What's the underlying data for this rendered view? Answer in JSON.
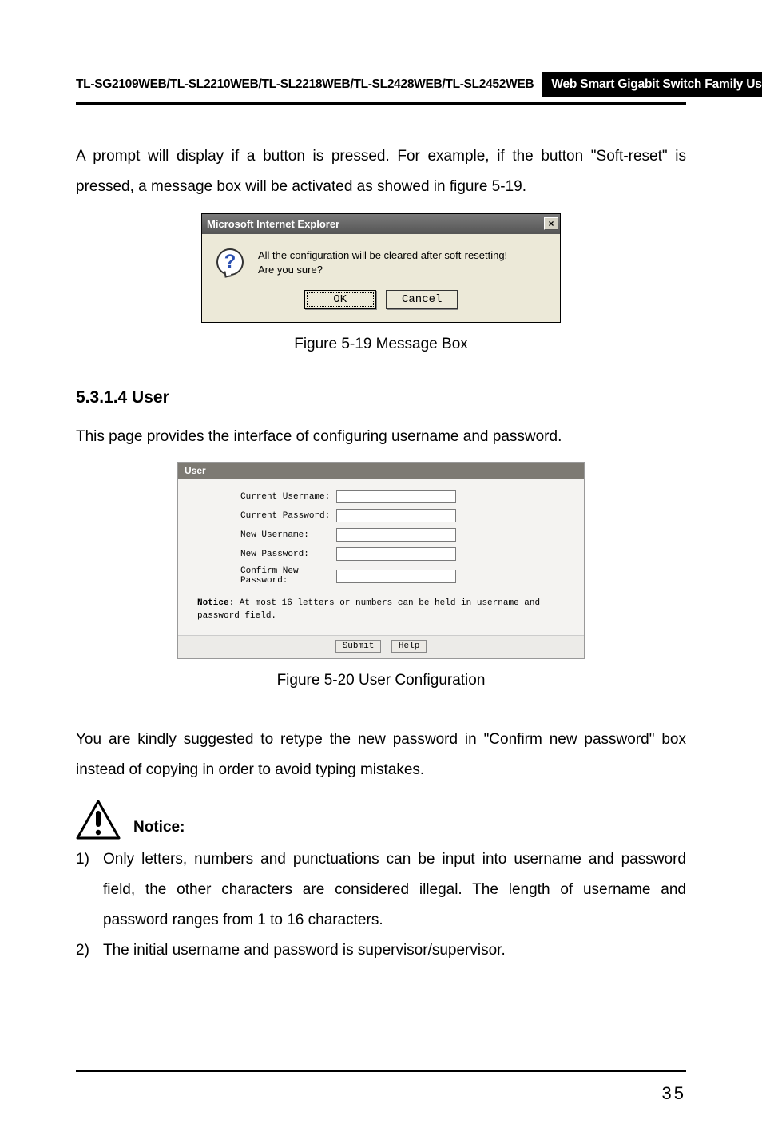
{
  "header": {
    "models": "TL-SG2109WEB/TL-SL2210WEB/TL-SL2218WEB/TL-SL2428WEB/TL-SL2452WEB",
    "guide": "Web Smart Gigabit Switch Family User's Guide"
  },
  "para1": "A prompt will display if a button is pressed. For example, if the button \"Soft-reset\" is pressed, a message box will be activated as showed in figure 5-19.",
  "msgbox": {
    "title": "Microsoft Internet Explorer",
    "close": "×",
    "question_glyph": "?",
    "line1": "All the configuration will be cleared after soft-resetting!",
    "line2": "Are you sure?",
    "ok": "OK",
    "cancel": "Cancel"
  },
  "caption1": "Figure 5-19  Message Box",
  "section_heading": "5.3.1.4  User",
  "para2": "This page provides the interface of configuring username and password.",
  "userpanel": {
    "title": "User",
    "rows": {
      "r1": "Current Username:",
      "r2": "Current Password:",
      "r3": "New Username:",
      "r4": "New Password:",
      "r5": "Confirm New Password:"
    },
    "notice_bold": "Notice",
    "notice_rest": ": At most 16 letters or numbers can be held in username and password field.",
    "submit": "Submit",
    "help": "Help"
  },
  "caption2": "Figure 5-20  User Configuration",
  "para3": "You are kindly suggested to retype the new password in \"Confirm new password\" box instead of copying in order to avoid typing mistakes.",
  "notice_label": "Notice",
  "notice_colon": ":",
  "list": {
    "n1": "1)",
    "b1": "Only letters, numbers and punctuations can be input into username and password field, the other characters are considered illegal. The length of username and password ranges from 1 to 16 characters.",
    "n2": "2)",
    "b2": "The initial username and password is supervisor/supervisor."
  },
  "page_number": "35"
}
